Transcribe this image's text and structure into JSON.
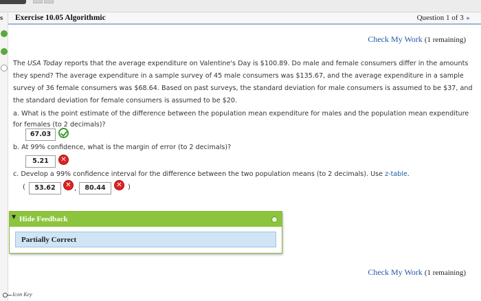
{
  "rail": {
    "label": "s"
  },
  "header": {
    "title": "Exercise 10.05 Algorithmic",
    "question_position": "Question 1 of 3",
    "next_glyph": "▸"
  },
  "check_top": {
    "link": "Check My Work",
    "remaining": "(1 remaining)"
  },
  "check_bottom": {
    "link": "Check My Work",
    "remaining": "(1 remaining)"
  },
  "problem": {
    "source": "USA Today",
    "p1": "The ",
    "p2": " reports that the average expenditure on Valentine's Day is $100.89. Do male and female consumers differ in the amounts they spend? The average expenditure in a sample survey of 45 male consumers was $135.67, and the average expenditure in a sample survey of 36 female consumers was $68.64. Based on past surveys, the standard deviation for male consumers is assumed to be $37, and the standard deviation for female consumers is assumed to be $20."
  },
  "parts": {
    "a": {
      "prompt": "a.  What is the point estimate of the difference between the population mean expenditure for males and the population mean expenditure for females (to 2 decimals)?",
      "answer": "67.03",
      "status": "correct"
    },
    "b": {
      "prompt": "b.  At 99% confidence, what is the margin of error (to 2 decimals)?",
      "answer": "5.21",
      "status": "incorrect"
    },
    "c": {
      "prompt": "c.  Develop a 99% confidence interval for the difference between the two population means (to 2 decimals). Use ",
      "link": "z-table",
      "after_link": ".",
      "lower": "53.62",
      "upper": "80.44",
      "open_paren": "(",
      "comma": ",",
      "close_paren": ")",
      "status_lower": "incorrect",
      "status_upper": "incorrect"
    }
  },
  "feedback": {
    "toggle_glyph": "▼",
    "title": "Hide Feedback",
    "status": "Partially Correct"
  },
  "footer": {
    "icon_key": "Icon Key"
  },
  "colors": {
    "link": "#1e5aa8",
    "correct": "#3a9a2b",
    "incorrect": "#dd2222",
    "feedback_header": "#8cc43d",
    "feedback_status_bg": "#cfe5f6"
  },
  "icons": {
    "correct": "check-circle-icon",
    "incorrect": "x-circle-icon",
    "key": "key-icon"
  }
}
